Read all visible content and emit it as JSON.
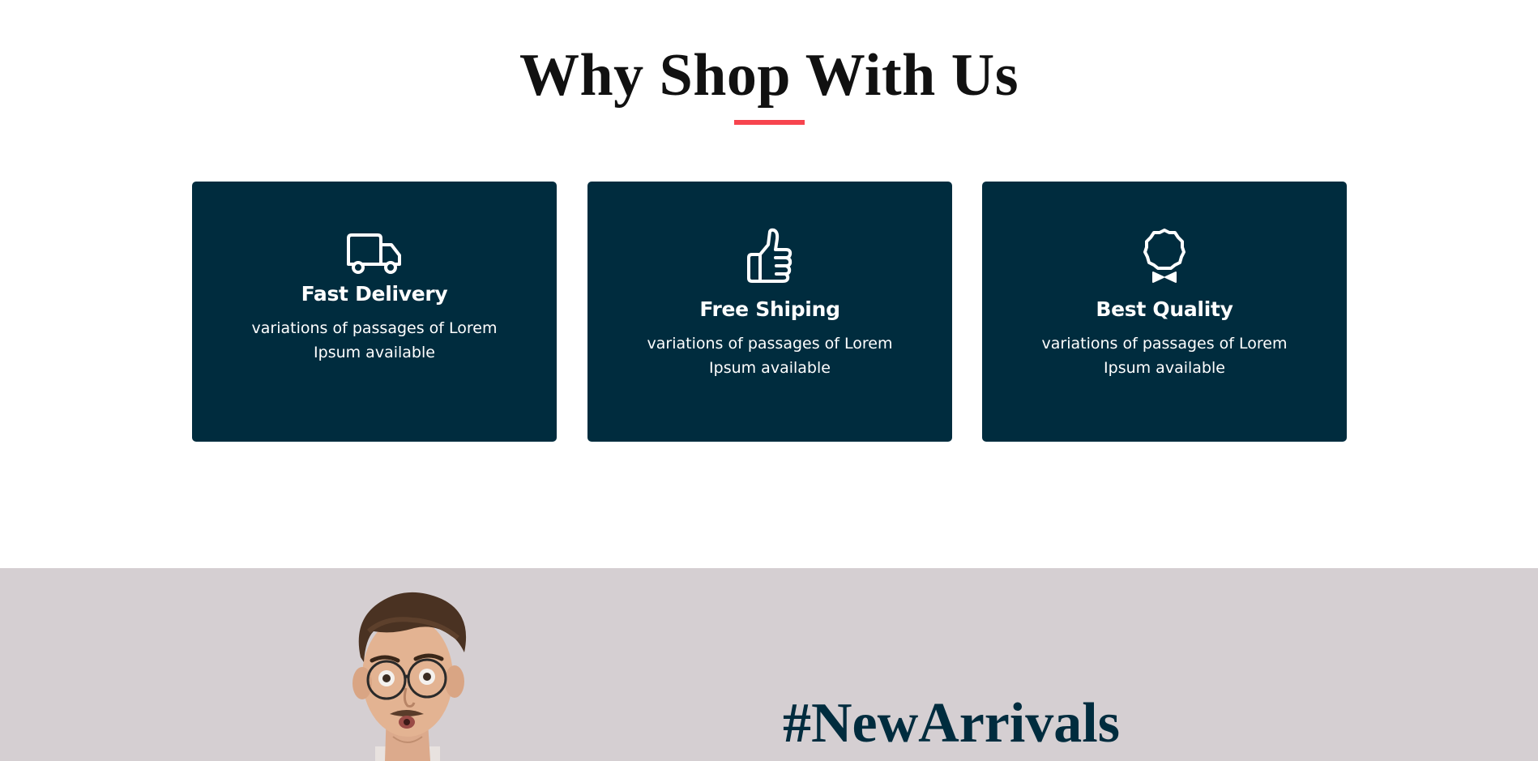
{
  "why_section": {
    "heading": "Why Shop With Us",
    "accent_color": "#f7444e",
    "card_color": "#002c3e",
    "cards": [
      {
        "icon": "truck-icon",
        "title": "Fast Delivery",
        "description": "variations of passages of Lorem Ipsum available"
      },
      {
        "icon": "thumbs-up-icon",
        "title": "Free Shiping",
        "description": "variations of passages of Lorem Ipsum available"
      },
      {
        "icon": "award-badge-icon",
        "title": "Best Quality",
        "description": "variations of passages of Lorem Ipsum available"
      }
    ]
  },
  "arrivals": {
    "title": "#NewArrivals",
    "background_color": "#d5cfd2"
  }
}
